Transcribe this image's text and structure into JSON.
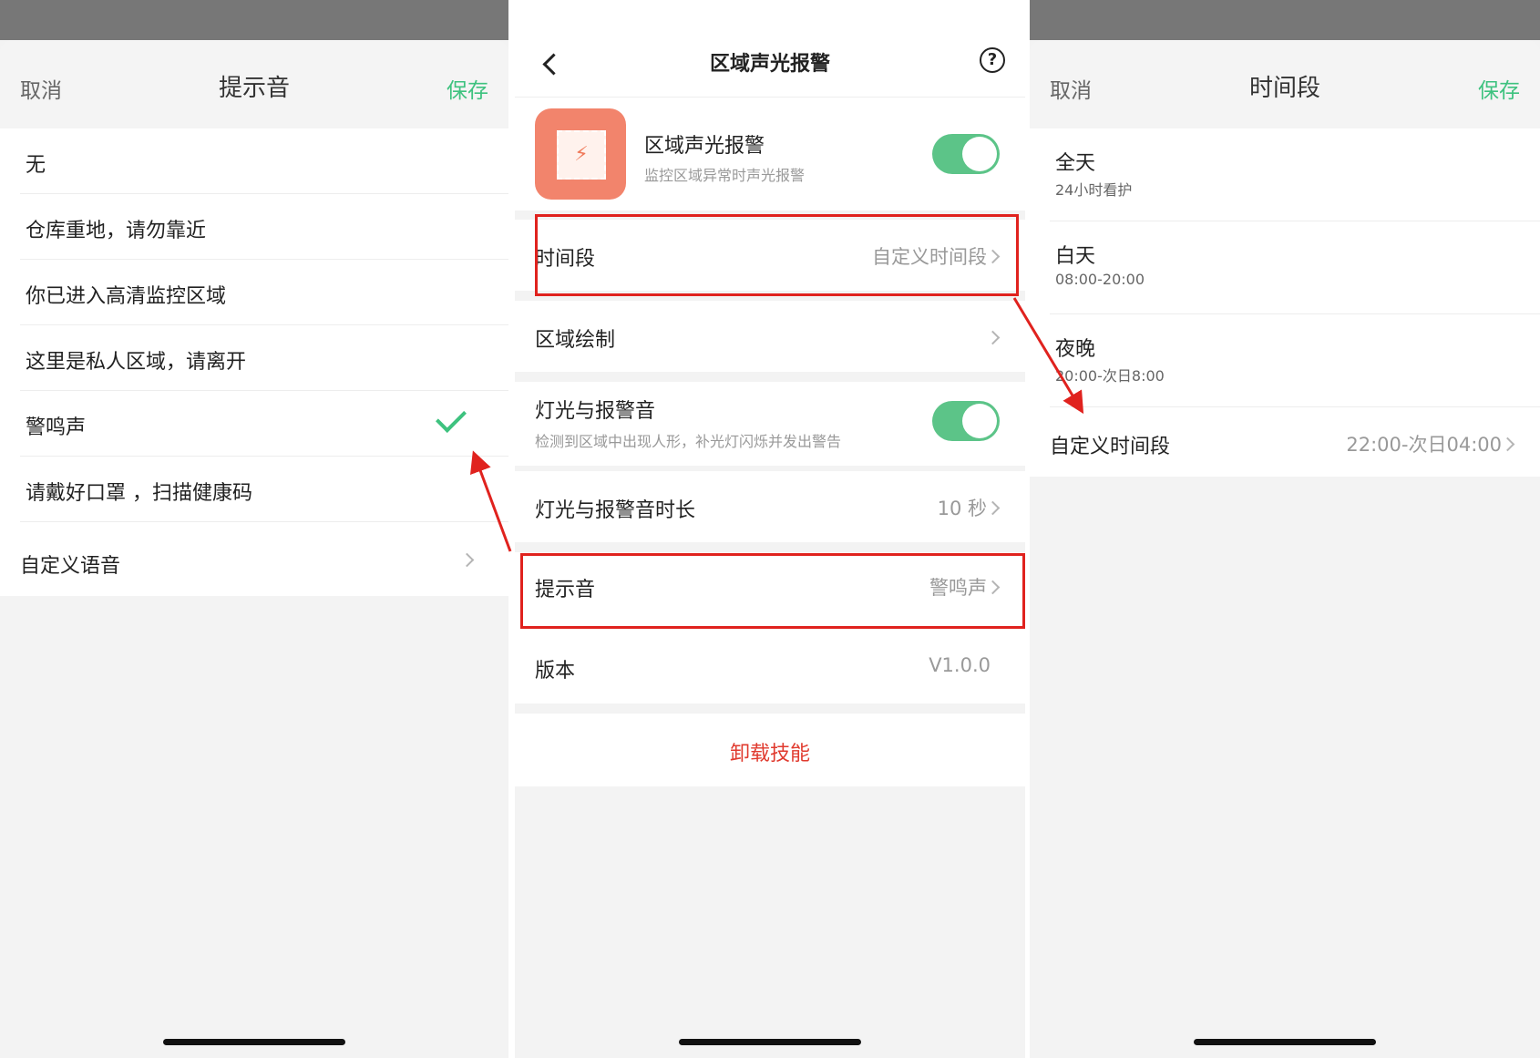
{
  "left_panel": {
    "cancel": "取消",
    "title": "提示音",
    "save": "保存",
    "options": [
      {
        "label": "无"
      },
      {
        "label": "仓库重地，请勿靠近"
      },
      {
        "label": "你已进入高清监控区域"
      },
      {
        "label": "这里是私人区域，请离开"
      },
      {
        "label": "警鸣声",
        "selected": true
      },
      {
        "label": "请戴好口罩 ，扫描健康码"
      }
    ],
    "custom_voice": "自定义语音"
  },
  "middle_panel": {
    "title": "区域声光报警",
    "help_icon": "?",
    "skill": {
      "name": "区域声光报警",
      "description": "监控区域异常时声光报警",
      "enabled": true
    },
    "time_period": {
      "label": "时间段",
      "value": "自定义时间段"
    },
    "area_drawing": {
      "label": "区域绘制"
    },
    "light_alarm": {
      "label": "灯光与报警音",
      "description": "检测到区域中出现人形，补光灯闪烁并发出警告",
      "enabled": true
    },
    "light_alarm_duration": {
      "label": "灯光与报警音时长",
      "value": "10 秒"
    },
    "prompt_sound": {
      "label": "提示音",
      "value": "警鸣声"
    },
    "version": {
      "label": "版本",
      "value": "V1.0.0"
    },
    "uninstall": "卸载技能"
  },
  "right_panel": {
    "cancel": "取消",
    "title": "时间段",
    "save": "保存",
    "options": [
      {
        "title": "全天",
        "subtitle": "24小时看护"
      },
      {
        "title": "白天",
        "subtitle": "08:00-20:00"
      },
      {
        "title": "夜晚",
        "subtitle": "20:00-次日8:00"
      }
    ],
    "custom": {
      "label": "自定义时间段",
      "value": "22:00-次日04:00"
    }
  },
  "colors": {
    "accent_green": "#3ec27f",
    "toggle_green": "#5cc488",
    "highlight_red": "#e0221e",
    "danger_red": "#e03a2e"
  }
}
